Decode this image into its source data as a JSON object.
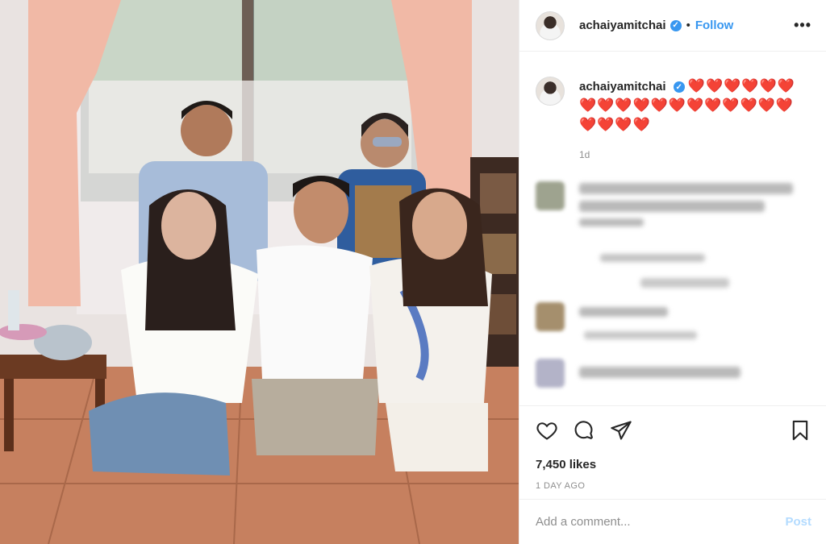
{
  "post": {
    "username": "achaiyamitchai",
    "follow_label": "Follow",
    "separator": "•",
    "more_label": "•••",
    "verified_mark": "✓",
    "caption_hearts": "❤️❤️❤️❤️❤️❤️❤️❤️❤️❤️❤️❤️❤️❤️❤️❤️❤️❤️❤️❤️❤️❤️",
    "caption_age": "1d",
    "likes": "7,450 likes",
    "date": "1 DAY AGO"
  },
  "comment_box": {
    "placeholder": "Add a comment...",
    "post_label": "Post"
  },
  "icons": [
    "heart-icon",
    "comment-icon",
    "share-icon",
    "bookmark-icon",
    "more-options-icon",
    "verified-badge-icon"
  ],
  "colors": {
    "accent": "#3897f0",
    "heart": "#e0245e",
    "muted": "#8e8e8e",
    "post_disabled": "#b3dbff"
  }
}
